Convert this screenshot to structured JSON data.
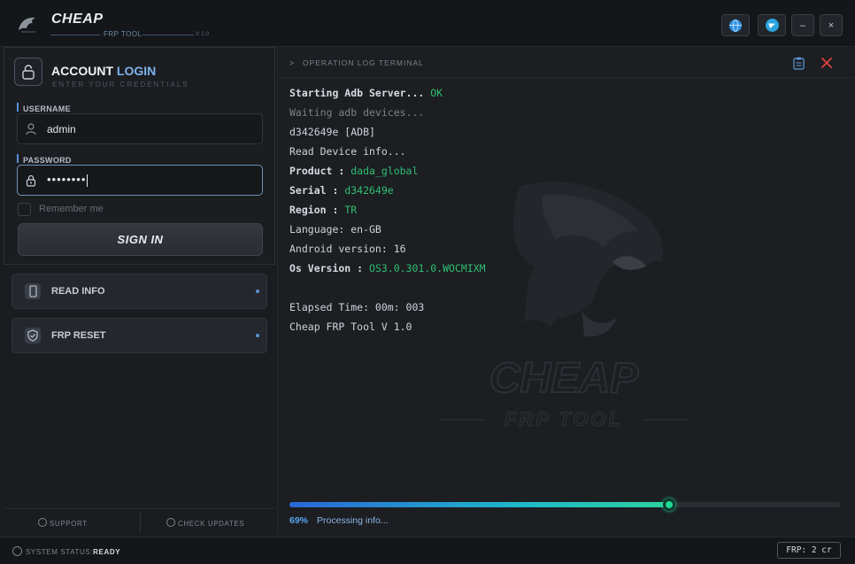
{
  "app": {
    "brand": "CHEAP",
    "subtitle": "FRP TOOL",
    "version": "V 1.0"
  },
  "window_controls": {
    "language_icon": "globe-icon",
    "telegram_icon": "telegram-icon",
    "minimize": "–",
    "close": "×"
  },
  "login": {
    "title_part1": "ACCOUNT",
    "title_part2": "LOGIN",
    "subtitle": "ENTER YOUR CREDENTIALS",
    "username_label": "USERNAME",
    "username_value": "admin",
    "password_label": "PASSWORD",
    "password_value": "••••••••",
    "remember_label": "Remember me",
    "signin_label": "SIGN IN"
  },
  "actions": [
    {
      "label": "READ INFO",
      "icon": "phone-icon"
    },
    {
      "label": "FRP RESET",
      "icon": "shield-check-icon"
    }
  ],
  "left_footer": {
    "support": "SUPPORT",
    "check_updates": "CHECK UPDATES"
  },
  "terminal": {
    "title": "OPERATION LOG TERMINAL",
    "lines": [
      {
        "key": "Starting Adb Server... ",
        "value": "OK"
      },
      {
        "text": "Waiting adb devices...",
        "dim": true
      },
      {
        "text": "d342649e [ADB]"
      },
      {
        "text": "Read Device info..."
      },
      {
        "key": "Product : ",
        "value": "dada_global"
      },
      {
        "key": "Serial : ",
        "value": "d342649e"
      },
      {
        "key": "Region : ",
        "value": "TR"
      },
      {
        "text": "Language: en-GB"
      },
      {
        "text": "Android version: 16"
      },
      {
        "key": "Os Version : ",
        "value": "OS3.0.301.0.WOCMIXM"
      },
      {
        "text": ""
      },
      {
        "text": "Elapsed Time: 00m: 003"
      },
      {
        "text": "Cheap FRP Tool V 1.0"
      }
    ],
    "watermark_line1": "CHEAP",
    "watermark_line2": "FRP TOOL"
  },
  "progress": {
    "percent_value": 69,
    "percent_label": "69%",
    "status": "Processing info..."
  },
  "statusbar": {
    "label": "SYSTEM STATUS:",
    "state": "READY",
    "credits": "FRP: 2 cr"
  },
  "colors": {
    "accent": "#5b8fd6",
    "ok_green": "#2fbf71",
    "close_red": "#e0423c"
  }
}
